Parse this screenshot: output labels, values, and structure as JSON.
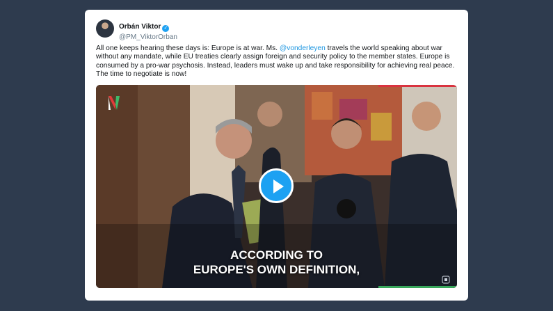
{
  "tweet": {
    "author_name": "Orbán Viktor",
    "handle": "@PM_ViktorOrban",
    "text_before_mention": "All one keeps hearing these days is: Europe is at war. Ms. ",
    "mention": "@vonderleyen",
    "text_after_mention": " travels the world speaking about war without any mandate, while EU treaties clearly assign foreign and security policy to the member states. Europe is consumed by a pro-war psychosis. Instead, leaders must wake up and take responsibility for achieving real peace. The time to negotiate is now!"
  },
  "video": {
    "caption_line1": "ACCORDING TO",
    "caption_line2": "EUROPE'S OWN DEFINITION,"
  },
  "colors": {
    "background": "#2e3b4e",
    "mention": "#1b95e0",
    "verified_badge": "#1da1f2",
    "play_button": "#1da1f2",
    "accent_red": "#d9333f",
    "accent_green": "#39a85c"
  }
}
